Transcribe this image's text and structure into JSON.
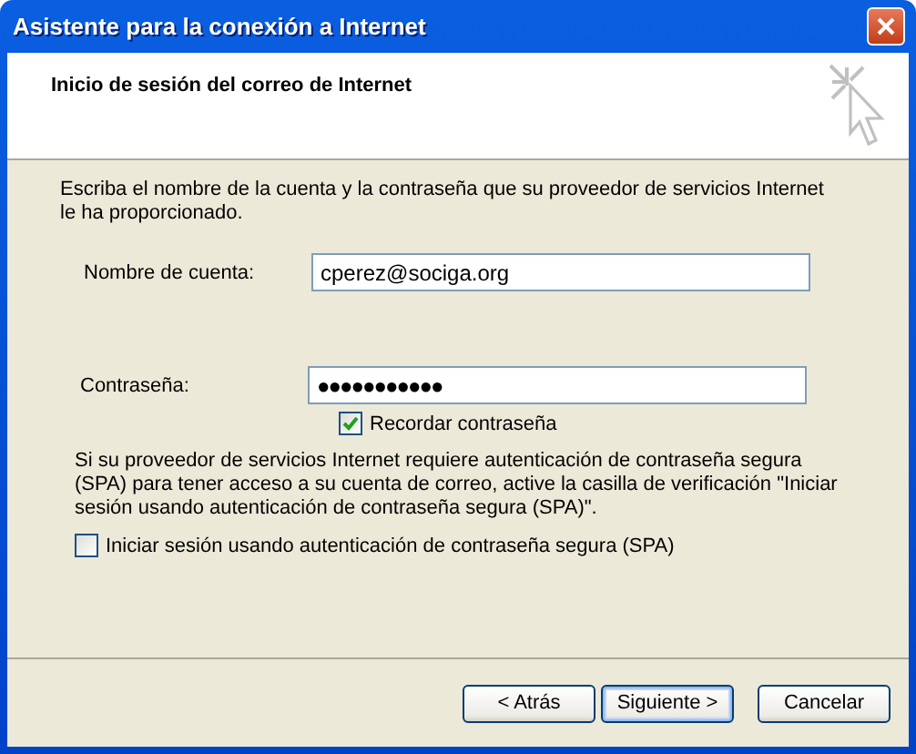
{
  "window": {
    "title": "Asistente para la conexión a Internet"
  },
  "header": {
    "title": "Inicio de sesión del correo de Internet"
  },
  "intro": "Escriba el nombre de la cuenta y la contraseña que su proveedor de servicios Internet le ha proporcionado.",
  "account": {
    "label": "Nombre de cuenta:",
    "value": "cperez@sociga.org"
  },
  "password": {
    "label": "Contraseña:",
    "value": "●●●●●●●●●●●"
  },
  "remember": {
    "label": "Recordar contraseña",
    "checked": true
  },
  "spa_note": "Si su proveedor de servicios Internet requiere autenticación de contraseña segura (SPA) para tener acceso a su cuenta de correo, active la casilla de verificación \"Iniciar sesión usando autenticación de contraseña segura (SPA)\".",
  "spa": {
    "label": "Iniciar sesión usando autenticación de contraseña segura (SPA)",
    "checked": false
  },
  "buttons": [
    {
      "label": "< Atrás",
      "default": false
    },
    {
      "label": "Siguiente >",
      "default": true
    },
    {
      "label": "Cancelar",
      "default": false
    }
  ]
}
